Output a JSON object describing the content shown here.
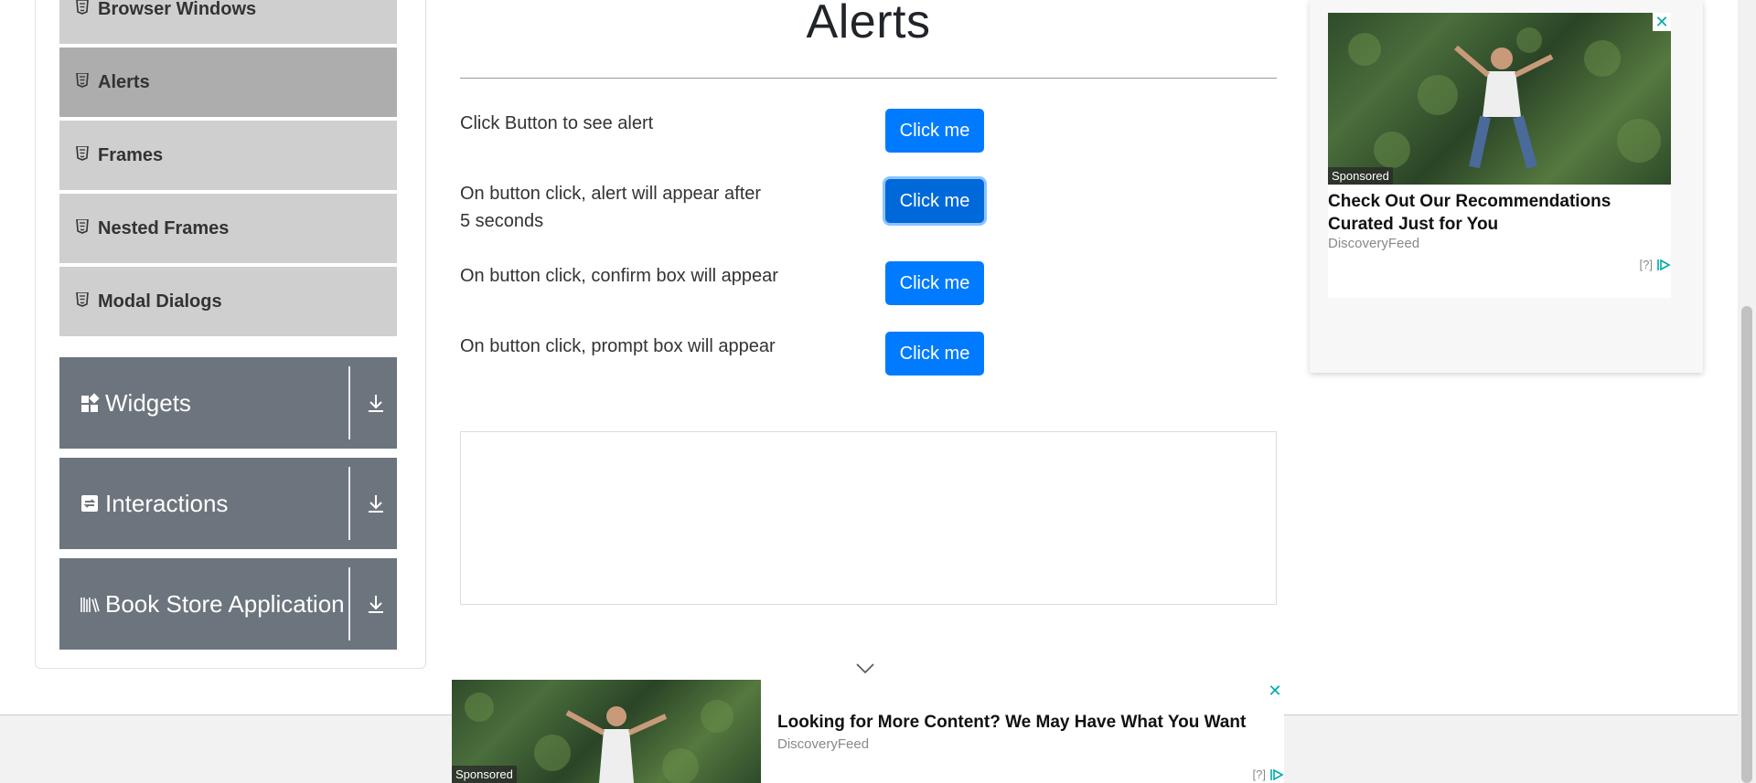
{
  "sidebar": {
    "sub_items": [
      {
        "label": "Browser Windows",
        "active": false
      },
      {
        "label": "Alerts",
        "active": true
      },
      {
        "label": "Frames",
        "active": false
      },
      {
        "label": "Nested Frames",
        "active": false
      },
      {
        "label": "Modal Dialogs",
        "active": false
      }
    ],
    "groups": [
      {
        "label": "Widgets",
        "icon": "widgets-icon"
      },
      {
        "label": "Interactions",
        "icon": "interactions-icon"
      },
      {
        "label": "Book Store Application",
        "icon": "bookstore-icon"
      }
    ]
  },
  "main": {
    "title": "Alerts",
    "rows": [
      {
        "label": "Click Button to see alert",
        "button": "Click me"
      },
      {
        "label": "On button click, alert will appear after 5 seconds",
        "button": "Click me"
      },
      {
        "label": "On button click, confirm box will appear",
        "button": "Click me"
      },
      {
        "label": "On button click, prompt box will appear",
        "button": "Click me"
      }
    ]
  },
  "right_ad": {
    "sponsored": "Sponsored",
    "title": "Check Out Our Recommendations Curated Just for You",
    "source": "DiscoveryFeed",
    "choices": "[?]",
    "close": "✕"
  },
  "bottom_ad": {
    "sponsored": "Sponsored",
    "title": "Looking for More Content? We May Have What You Want",
    "source": "DiscoveryFeed",
    "choices": "[?]",
    "close": "✕"
  },
  "colors": {
    "primary": "#007bff",
    "group_bg": "#6c757d",
    "sub_item_bg": "#cfcfcf",
    "sub_item_active_bg": "#adadad"
  }
}
